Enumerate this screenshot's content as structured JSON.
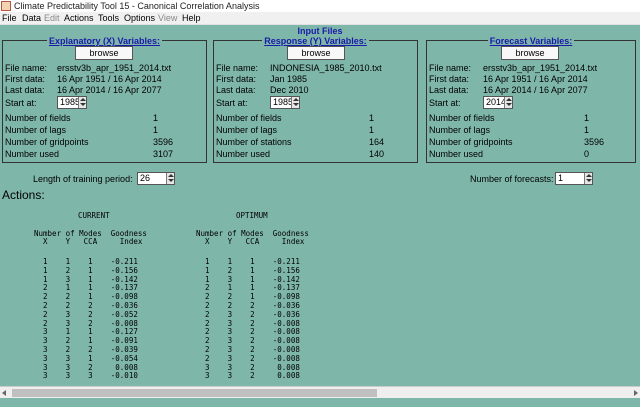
{
  "window": {
    "title": "Climate Predictability Tool 15 - Canonical Correlation Analysis"
  },
  "menu": {
    "file": "File",
    "data": "Data",
    "edit": "Edit",
    "actions": "Actions",
    "tools": "Tools",
    "options": "Options",
    "view": "View",
    "help": "Help"
  },
  "input_files_label": "Input Files",
  "x_panel": {
    "title": "Explanatory (X) Variables:",
    "browse": "browse",
    "file_label": "File name:",
    "file_value": "ersstv3b_apr_1951_2014.txt",
    "first_label": "First data:",
    "first_value": "16 Apr 1951 / 16 Apr 2014",
    "last_label": "Last data:",
    "last_value": "16 Apr 2014 / 16 Apr 2077",
    "start_label": "Start at:",
    "start_value": "1985",
    "fields_label": "Number of fields",
    "fields_value": "1",
    "lags_label": "Number of lags",
    "lags_value": "1",
    "grid_label": "Number of gridpoints",
    "grid_value": "3596",
    "used_label": "Number used",
    "used_value": "3107"
  },
  "y_panel": {
    "title": "Response (Y) Variables:",
    "browse": "browse",
    "file_label": "File name:",
    "file_value": "INDONESIA_1985_2010.txt",
    "first_label": "First data:",
    "first_value": "Jan 1985",
    "last_label": "Last data:",
    "last_value": "Dec 2010",
    "start_label": "Start at:",
    "start_value": "1985",
    "fields_label": "Number of fields",
    "fields_value": "1",
    "lags_label": "Number of lags",
    "lags_value": "1",
    "grid_label": "Number of stations",
    "grid_value": "164",
    "used_label": "Number used",
    "used_value": "140"
  },
  "f_panel": {
    "title": "Forecast Variables:",
    "browse": "browse",
    "file_label": "File name:",
    "file_value": "ersstv3b_apr_1951_2014.txt",
    "first_label": "First data:",
    "first_value": "16 Apr 1951 / 16 Apr 2014",
    "last_label": "Last data:",
    "last_value": "16 Apr 2014 / 16 Apr 2077",
    "start_label": "Start at:",
    "start_value": "2014",
    "fields_label": "Number of fields",
    "fields_value": "1",
    "lags_label": "Number of lags",
    "lags_value": "1",
    "grid_label": "Number of gridpoints",
    "grid_value": "3596",
    "used_label": "Number used",
    "used_value": "0"
  },
  "training": {
    "label": "Length of training period:",
    "value": "26"
  },
  "forecasts": {
    "label": "Number of forecasts:",
    "value": "1"
  },
  "actions_label": "Actions:",
  "output": {
    "current_heading": "CURRENT",
    "optimum_heading": "OPTIMUM",
    "header1": "Number of Modes  Goodness",
    "header2": "  X    Y   CCA     Index",
    "rows": [
      "  1    1    1    -0.211",
      "  1    2    1    -0.156",
      "  1    3    1    -0.142",
      "  2    1    1    -0.137",
      "  2    2    1    -0.098",
      "  2    2    2    -0.036",
      "  2    3    2    -0.052",
      "  2    3    2    -0.008",
      "  3    1    1    -0.127",
      "  3    2    1    -0.091",
      "  3    2    2    -0.039",
      "  3    3    1    -0.054",
      "  3    3    2     0.008",
      "  3    3    3    -0.010"
    ],
    "optimum_rows": [
      "  1    1    1    -0.211",
      "  1    2    1    -0.156",
      "  1    3    1    -0.142",
      "  2    1    1    -0.137",
      "  2    2    1    -0.098",
      "  2    2    2    -0.036",
      "  2    3    2    -0.036",
      "  2    3    2    -0.008",
      "  2    3    2    -0.008",
      "  2    3    2    -0.008",
      "  2    3    2    -0.008",
      "  2    3    2    -0.008",
      "  3    3    2     0.008",
      "  3    3    2     0.008"
    ]
  }
}
